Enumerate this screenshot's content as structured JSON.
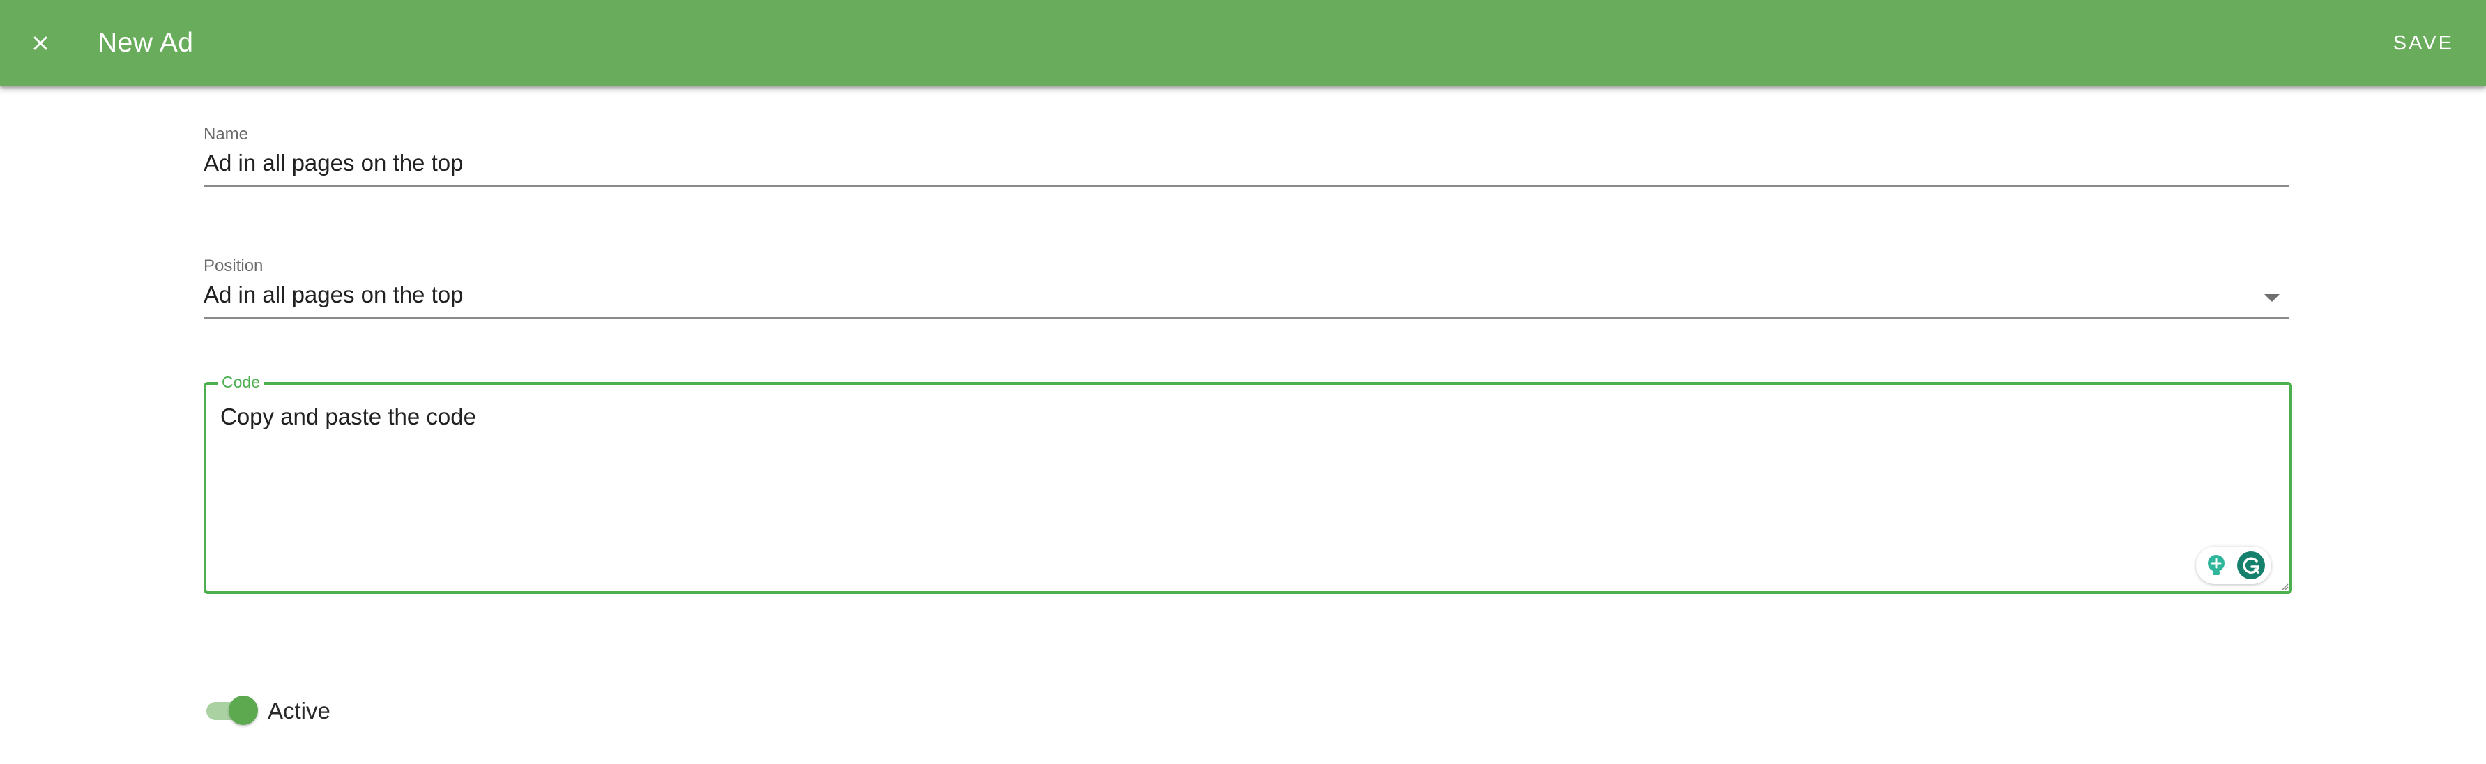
{
  "header": {
    "title": "New Ad",
    "close_icon": "close-icon",
    "save_label": "SAVE",
    "bar_color": "#69ac5c"
  },
  "form": {
    "name": {
      "label": "Name",
      "value": "Ad in all pages on the top"
    },
    "position": {
      "label": "Position",
      "value": "Ad in all pages on the top",
      "icon": "dropdown-arrow-icon"
    },
    "code": {
      "label": "Code",
      "value": "Copy and paste the code",
      "accent_color": "#4caf50",
      "assistant_icons": [
        "lightbulb-icon",
        "grammarly-icon"
      ]
    },
    "active": {
      "label": "Active",
      "checked": true
    }
  }
}
